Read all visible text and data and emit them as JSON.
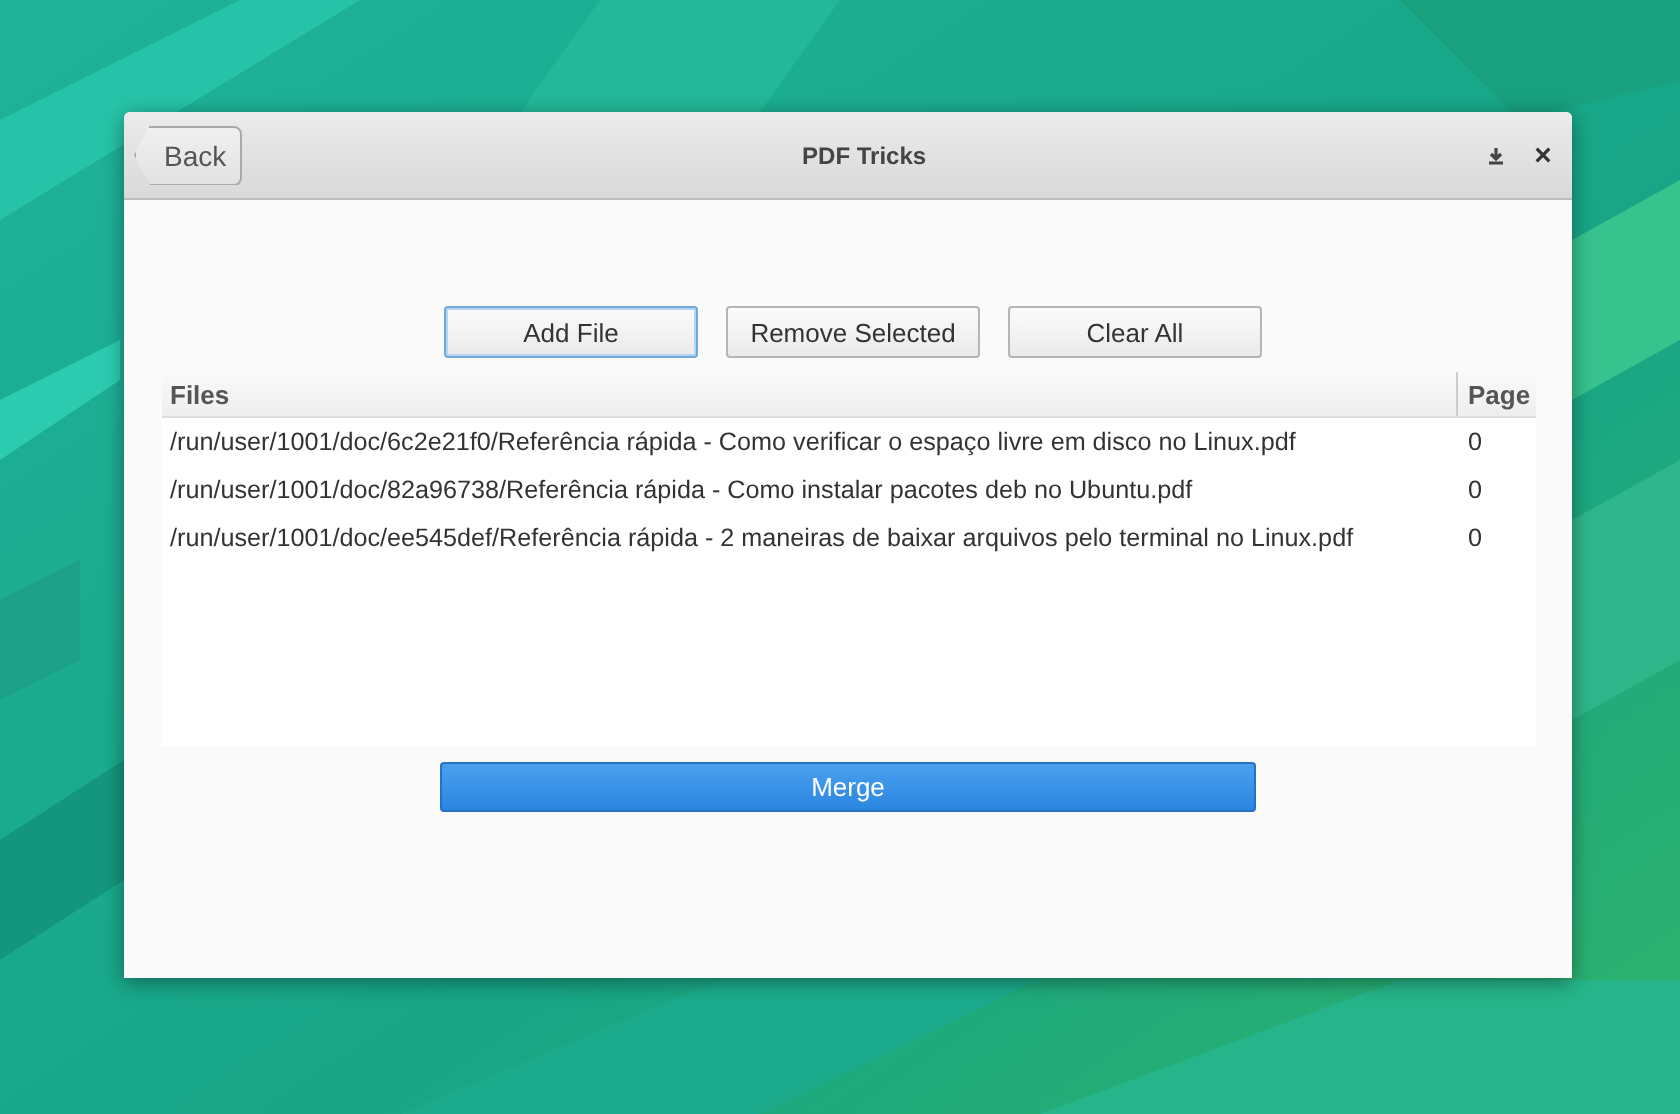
{
  "window": {
    "title": "PDF Tricks",
    "back": "Back"
  },
  "buttons": [
    {
      "label": "Add File",
      "focused": true
    },
    {
      "label": "Remove Selected",
      "focused": false
    },
    {
      "label": "Clear All",
      "focused": false
    }
  ],
  "table": {
    "columns": [
      "Files",
      "Page"
    ],
    "rows": [
      [
        "/run/user/1001/doc/6c2e21f0/Referência rápida - Como verificar o espaço livre em disco no Linux.pdf",
        "0"
      ],
      [
        "/run/user/1001/doc/82a96738/Referência rápida - Como instalar pacotes deb no Ubuntu.pdf",
        "0"
      ],
      [
        "/run/user/1001/doc/ee545def/Referência rápida - 2 maneiras de baixar arquivos pelo terminal no Linux.pdf",
        "0"
      ]
    ]
  },
  "merge": "Merge"
}
